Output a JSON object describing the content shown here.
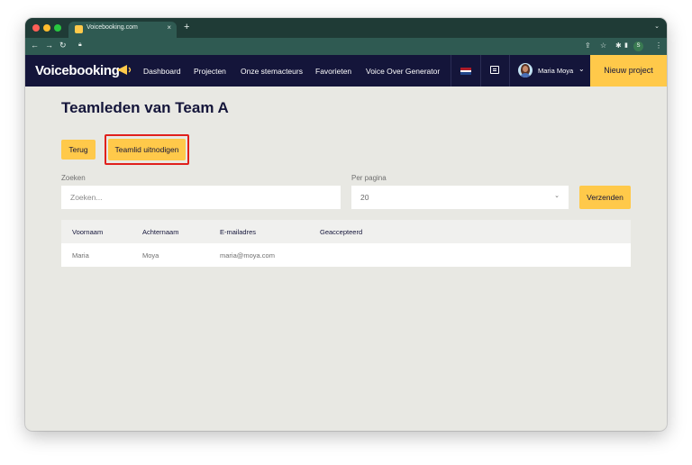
{
  "browser": {
    "tab_title": "Voicebooking.com",
    "tab_close": "×",
    "new_tab": "+",
    "tabs_menu": "⌄",
    "profile_initial": "S"
  },
  "header": {
    "logo_text": "Voicebooking",
    "nav": [
      "Dashboard",
      "Projecten",
      "Onze stemacteurs",
      "Favorieten",
      "Voice Over Generator"
    ],
    "user_name": "Maria Moya",
    "user_caret": "⌄",
    "new_project_label": "Nieuw project"
  },
  "page": {
    "title": "Teamleden van Team A",
    "back_label": "Terug",
    "invite_label": "Teamlid uitnodigen",
    "search_label": "Zoeken",
    "search_placeholder": "Zoeken...",
    "per_page_label": "Per pagina",
    "per_page_value": "20",
    "send_label": "Verzenden"
  },
  "table": {
    "columns": [
      "Voornaam",
      "Achternaam",
      "E-mailadres",
      "Geaccepteerd"
    ],
    "rows": [
      [
        "Maria",
        "Moya",
        "maria@moya.com",
        ""
      ]
    ]
  },
  "colors": {
    "accent": "#ffc94a",
    "header_bg": "#14153a",
    "chrome_bg": "#1f3b36",
    "page_bg": "#e8e8e3",
    "highlight": "#e0201c"
  }
}
